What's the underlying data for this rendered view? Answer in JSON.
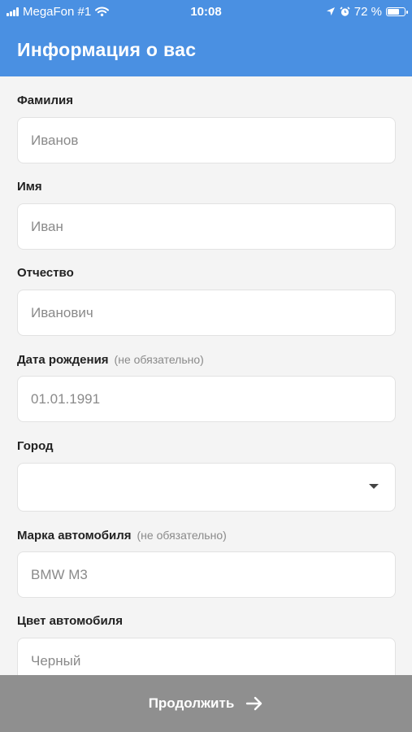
{
  "status": {
    "carrier": "MegaFon #1",
    "time": "10:08",
    "battery_text": "72 %",
    "battery_level": 0.72
  },
  "header": {
    "title": "Информация о вас"
  },
  "form": {
    "last_name": {
      "label": "Фамилия",
      "placeholder": "Иванов"
    },
    "first_name": {
      "label": "Имя",
      "placeholder": "Иван"
    },
    "patronymic": {
      "label": "Отчество",
      "placeholder": "Иванович"
    },
    "birth_date": {
      "label": "Дата рождения",
      "optional": "(не обязательно)",
      "placeholder": "01.01.1991"
    },
    "city": {
      "label": "Город",
      "value": ""
    },
    "car_brand": {
      "label": "Марка автомобиля",
      "optional": "(не обязательно)",
      "placeholder": "BMW M3"
    },
    "car_color": {
      "label": "Цвет автомобиля",
      "placeholder": "Черный"
    }
  },
  "footer": {
    "continue_label": "Продолжить"
  }
}
